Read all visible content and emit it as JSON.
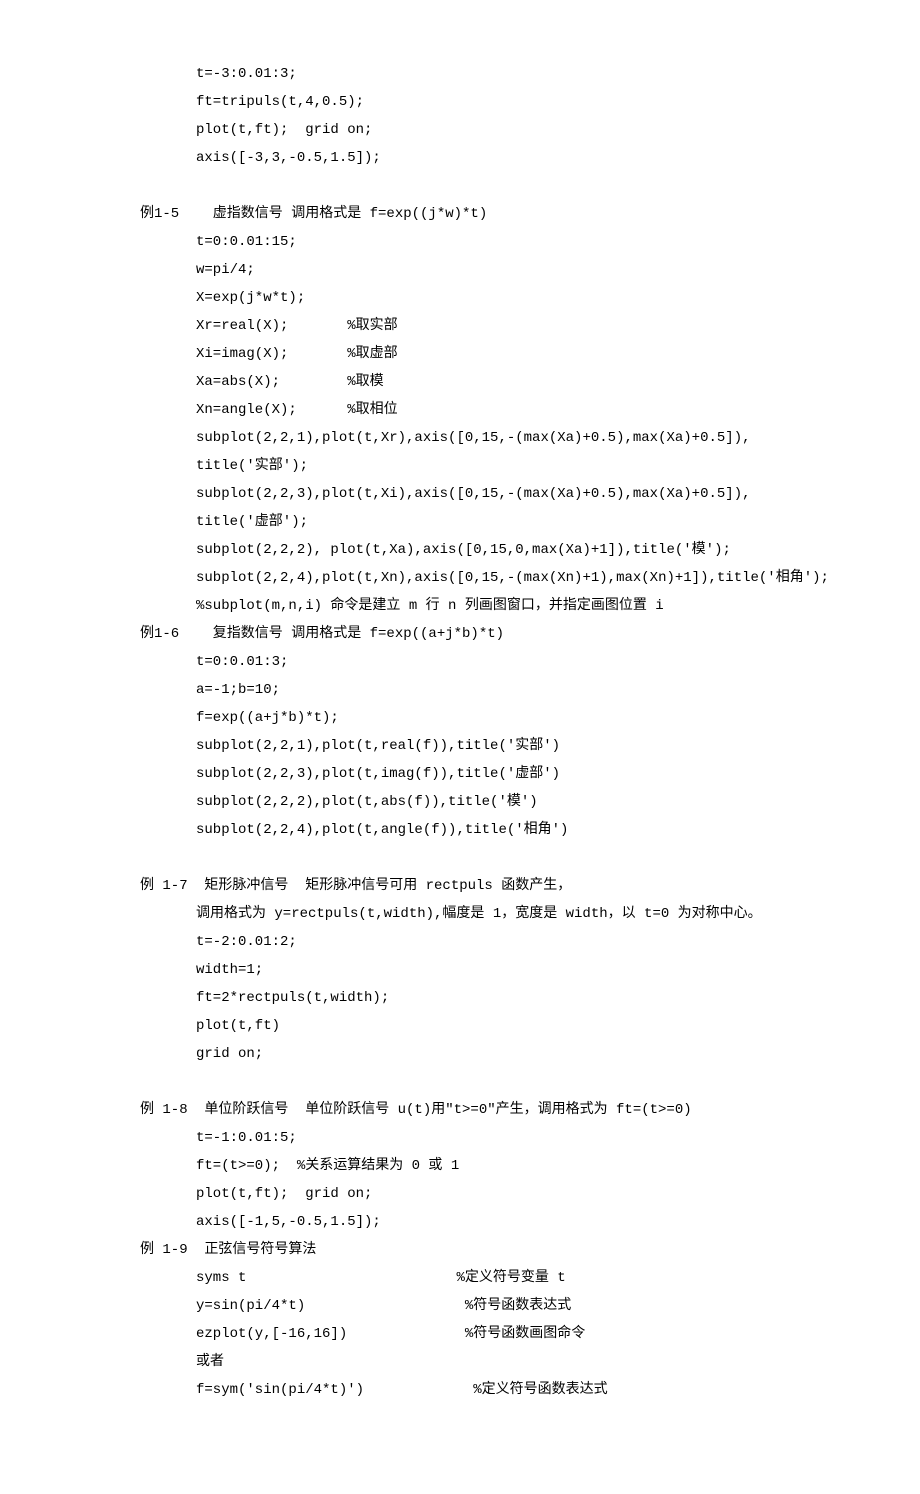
{
  "block0": [
    "t=-3:0.01:3;",
    "ft=tripuls(t,4,0.5);",
    "plot(t,ft);  grid on;",
    "axis([-3,3,-0.5,1.5]);"
  ],
  "ex15_header": "例1-5    虚指数信号 调用格式是 f=exp((j*w)*t)",
  "ex15": [
    "t=0:0.01:15;",
    "w=pi/4;",
    "X=exp(j*w*t);",
    "Xr=real(X);       %取实部",
    "Xi=imag(X);       %取虚部",
    "Xa=abs(X);        %取模",
    "Xn=angle(X);      %取相位",
    "subplot(2,2,1),plot(t,Xr),axis([0,15,-(max(Xa)+0.5),max(Xa)+0.5]),",
    "title('实部');",
    "subplot(2,2,3),plot(t,Xi),axis([0,15,-(max(Xa)+0.5),max(Xa)+0.5]),",
    "title('虚部');",
    "subplot(2,2,2), plot(t,Xa),axis([0,15,0,max(Xa)+1]),title('模');",
    "subplot(2,2,4),plot(t,Xn),axis([0,15,-(max(Xn)+1),max(Xn)+1]),title('相角');",
    "%subplot(m,n,i) 命令是建立 m 行 n 列画图窗口，并指定画图位置 i"
  ],
  "ex16_header": "例1-6    复指数信号 调用格式是 f=exp((a+j*b)*t)",
  "ex16": [
    "t=0:0.01:3;",
    "a=-1;b=10;",
    "f=exp((a+j*b)*t);",
    "subplot(2,2,1),plot(t,real(f)),title('实部')",
    "subplot(2,2,3),plot(t,imag(f)),title('虚部')",
    "subplot(2,2,2),plot(t,abs(f)),title('模')",
    "subplot(2,2,4),plot(t,angle(f)),title('相角')"
  ],
  "ex17_header": "例 1-7  矩形脉冲信号  矩形脉冲信号可用 rectpuls 函数产生，",
  "ex17_sub": "调用格式为 y=rectpuls(t,width),幅度是 1，宽度是 width，以 t=0 为对称中心。",
  "ex17": [
    "t=-2:0.01:2;",
    "width=1;",
    "ft=2*rectpuls(t,width);",
    "plot(t,ft)",
    "grid on;"
  ],
  "ex18_header": "例 1-8  单位阶跃信号  单位阶跃信号 u(t)用\"t>=0\"产生，调用格式为 ft=(t>=0)",
  "ex18": [
    "t=-1:0.01:5;",
    "ft=(t>=0);  %关系运算结果为 0 或 1",
    "plot(t,ft);  grid on;",
    "axis([-1,5,-0.5,1.5]);"
  ],
  "ex19_header": "例 1-9  正弦信号符号算法",
  "ex19": [
    "syms t                         %定义符号变量 t",
    "y=sin(pi/4*t)                   %符号函数表达式",
    "ezplot(y,[-16,16])              %符号函数画图命令",
    "或者",
    "f=sym('sin(pi/4*t)')             %定义符号函数表达式"
  ]
}
